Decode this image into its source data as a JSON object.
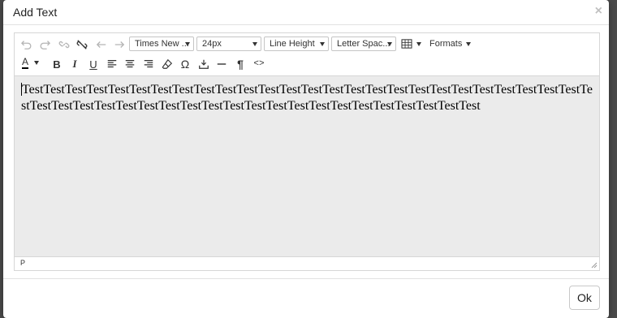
{
  "dialog": {
    "title": "Add Text",
    "close_glyph": "×",
    "ok_label": "Ok"
  },
  "toolbar": {
    "undo_icon": "undo-icon",
    "redo_icon": "redo-icon",
    "link_icon": "link-icon",
    "unlink_icon": "unlink-icon",
    "arrow_left_icon": "arrow-left-icon",
    "arrow_right_icon": "arrow-right-icon",
    "font_family": "Times New ...",
    "font_size": "24px",
    "line_height": "Line Height",
    "letter_spacing": "Letter Spac...",
    "table_icon": "table-icon",
    "formats_label": "Formats",
    "text_color_glyph": "A",
    "bold_glyph": "B",
    "italic_glyph": "I",
    "underline_glyph": "U",
    "omega_glyph": "Ω",
    "paragraph_glyph": "¶",
    "code_glyph": "<>"
  },
  "editor": {
    "content": "TestTestTestTestTestTestTestTestTestTestTestTestTestTestTestTestTestTestTestTestTestTestTestTestTestTestTestTestTestTestTestTestTestTestTestTestTestTestTestTestTestTestTestTestTestTestTestTest",
    "path": "P"
  },
  "colors": {
    "content_bg": "#ebebeb",
    "text_color_underline": "#000000",
    "disabled_icon": "#b5b5b5"
  }
}
